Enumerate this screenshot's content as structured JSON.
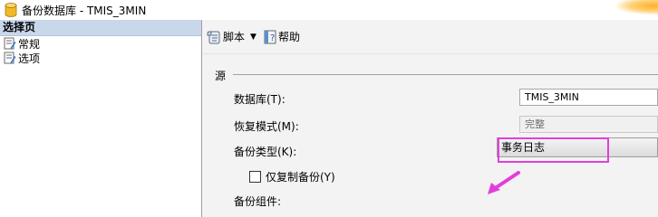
{
  "window": {
    "title": "备份数据库 - TMIS_3MIN"
  },
  "left_pane": {
    "header": "选择页",
    "items": [
      {
        "label": "常规"
      },
      {
        "label": "选项"
      }
    ]
  },
  "toolbar": {
    "script_label": "脚本",
    "dropdown_glyph": "▼",
    "help_label": "帮助"
  },
  "form": {
    "section_label": "源",
    "database_label": "数据库(T):",
    "database_value": "TMIS_3MIN",
    "recovery_label": "恢复模式(M):",
    "recovery_value": "完整",
    "backup_type_label": "备份类型(K):",
    "backup_type_value": "事务日志",
    "copy_only_label": "仅复制备份(Y)",
    "component_label": "备份组件:"
  },
  "colors": {
    "annotation": "#e23fd9",
    "pane_header": "#c9d7ea"
  }
}
